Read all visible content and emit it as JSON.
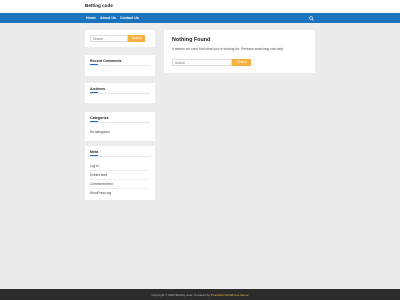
{
  "site": {
    "title": "Betting code"
  },
  "nav": {
    "items": [
      {
        "label": "Home"
      },
      {
        "label": "About Us"
      },
      {
        "label": "Contact Us"
      }
    ],
    "search_icon": "search-icon"
  },
  "sidebar": {
    "search": {
      "placeholder": "Search ...",
      "button": "Search"
    },
    "recent_comments": {
      "title": "Recent Comments"
    },
    "archives": {
      "title": "Archives"
    },
    "categories": {
      "title": "Categories",
      "empty": "No categories"
    },
    "meta": {
      "title": "Meta",
      "links": [
        {
          "label": "Log in"
        },
        {
          "label": "Entries feed"
        },
        {
          "label": "Comments feed"
        },
        {
          "label": "WordPress.org"
        }
      ]
    }
  },
  "main": {
    "title": "Nothing Found",
    "text": "It seems we can't find what you're looking for. Perhaps searching can help.",
    "search": {
      "placeholder": "Search ...",
      "button": "Search"
    }
  },
  "footer": {
    "prefix": "Copyright © 2023 Betting code. Powered by",
    "theme_link": "Proudhub WordPress theme"
  },
  "colors": {
    "nav": "#1e73be",
    "accent": "#f5b041",
    "footer": "#2b2b2b",
    "background": "#ececec"
  }
}
